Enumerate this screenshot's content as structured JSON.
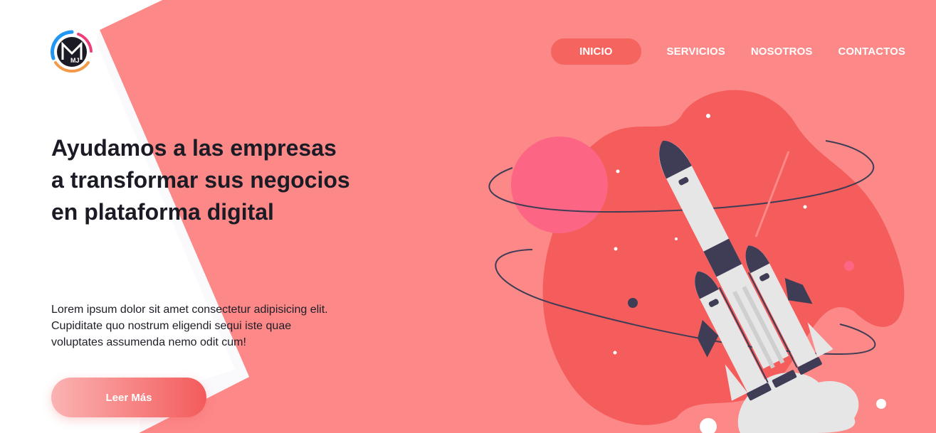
{
  "brand": {
    "logo_text": "MJ"
  },
  "nav": {
    "items": [
      {
        "label": "INICIO",
        "active": true
      },
      {
        "label": "SERVICIOS"
      },
      {
        "label": "NOSOTROS"
      },
      {
        "label": "CONTACTOS"
      }
    ]
  },
  "hero": {
    "title": "Ayudamos a las empresas a transformar sus negocios en plataforma digital",
    "body": "Lorem ipsum dolor sit amet consectetur adipisicing elit. Cupiditate quo nostrum eligendi sequi iste quae voluptates assumenda nemo odit cum!",
    "cta_label": "Leer Más"
  },
  "colors": {
    "background_salmon": "#fc8888",
    "active_pill": "#f5645e",
    "blob": "#f55c5c",
    "planet": "#fd6584",
    "dark": "#3f3d56",
    "rocket_body": "#e6e6e6"
  },
  "icons": [
    "logo-icon",
    "rocket-illustration"
  ]
}
